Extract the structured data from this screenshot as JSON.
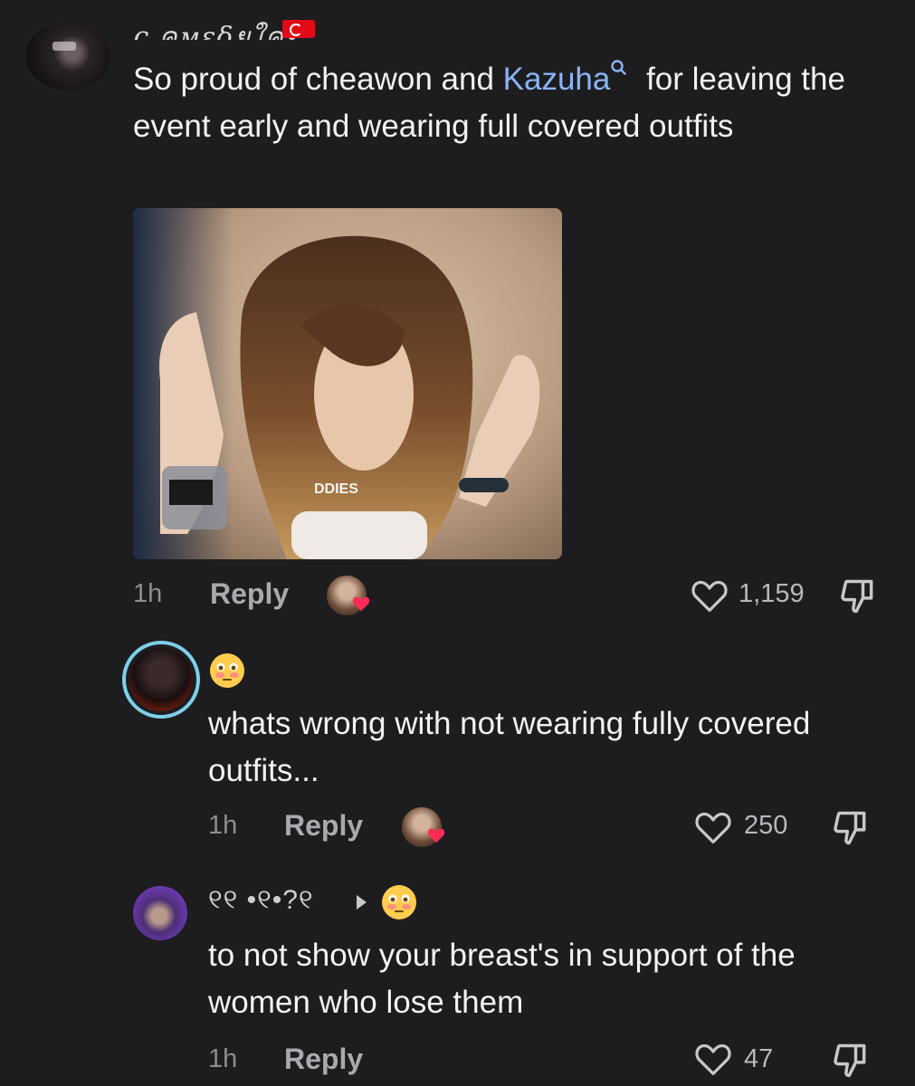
{
  "comments": [
    {
      "username": "ς คмεδยใค•",
      "text_before": "So proud of cheawon and ",
      "mention": "Kazuha",
      "text_after": " for leaving the event early and wearing full covered outfits",
      "photo_caption": "DDIES",
      "time": "1h",
      "reply_label": "Reply",
      "likes": "1,159",
      "icons": {
        "avatar": "user-avatar",
        "like": "heart-outline-icon",
        "dislike": "thumbs-down-icon",
        "liked_by_creator": "creator-liked-badge",
        "search": "search-icon",
        "flag": "turkey-flag"
      }
    },
    {
      "username_emoji": "😳",
      "text": "whats wrong with not wearing fully covered outfits...",
      "time": "1h",
      "reply_label": "Reply",
      "likes": "250"
    },
    {
      "username": "୧୧ •୧•?୧",
      "reply_to_emoji": "😳",
      "text": "to not show your breast's in support of the women who lose them",
      "time": "1h",
      "reply_label": "Reply",
      "likes": "47"
    }
  ],
  "colors": {
    "background": "#1d1d1f",
    "mention": "#8ab4f8",
    "text": "#f2f2f2",
    "meta": "#8d8d92",
    "heart_badge": "#fe2c55",
    "story_ring": "#7ed0ea"
  }
}
